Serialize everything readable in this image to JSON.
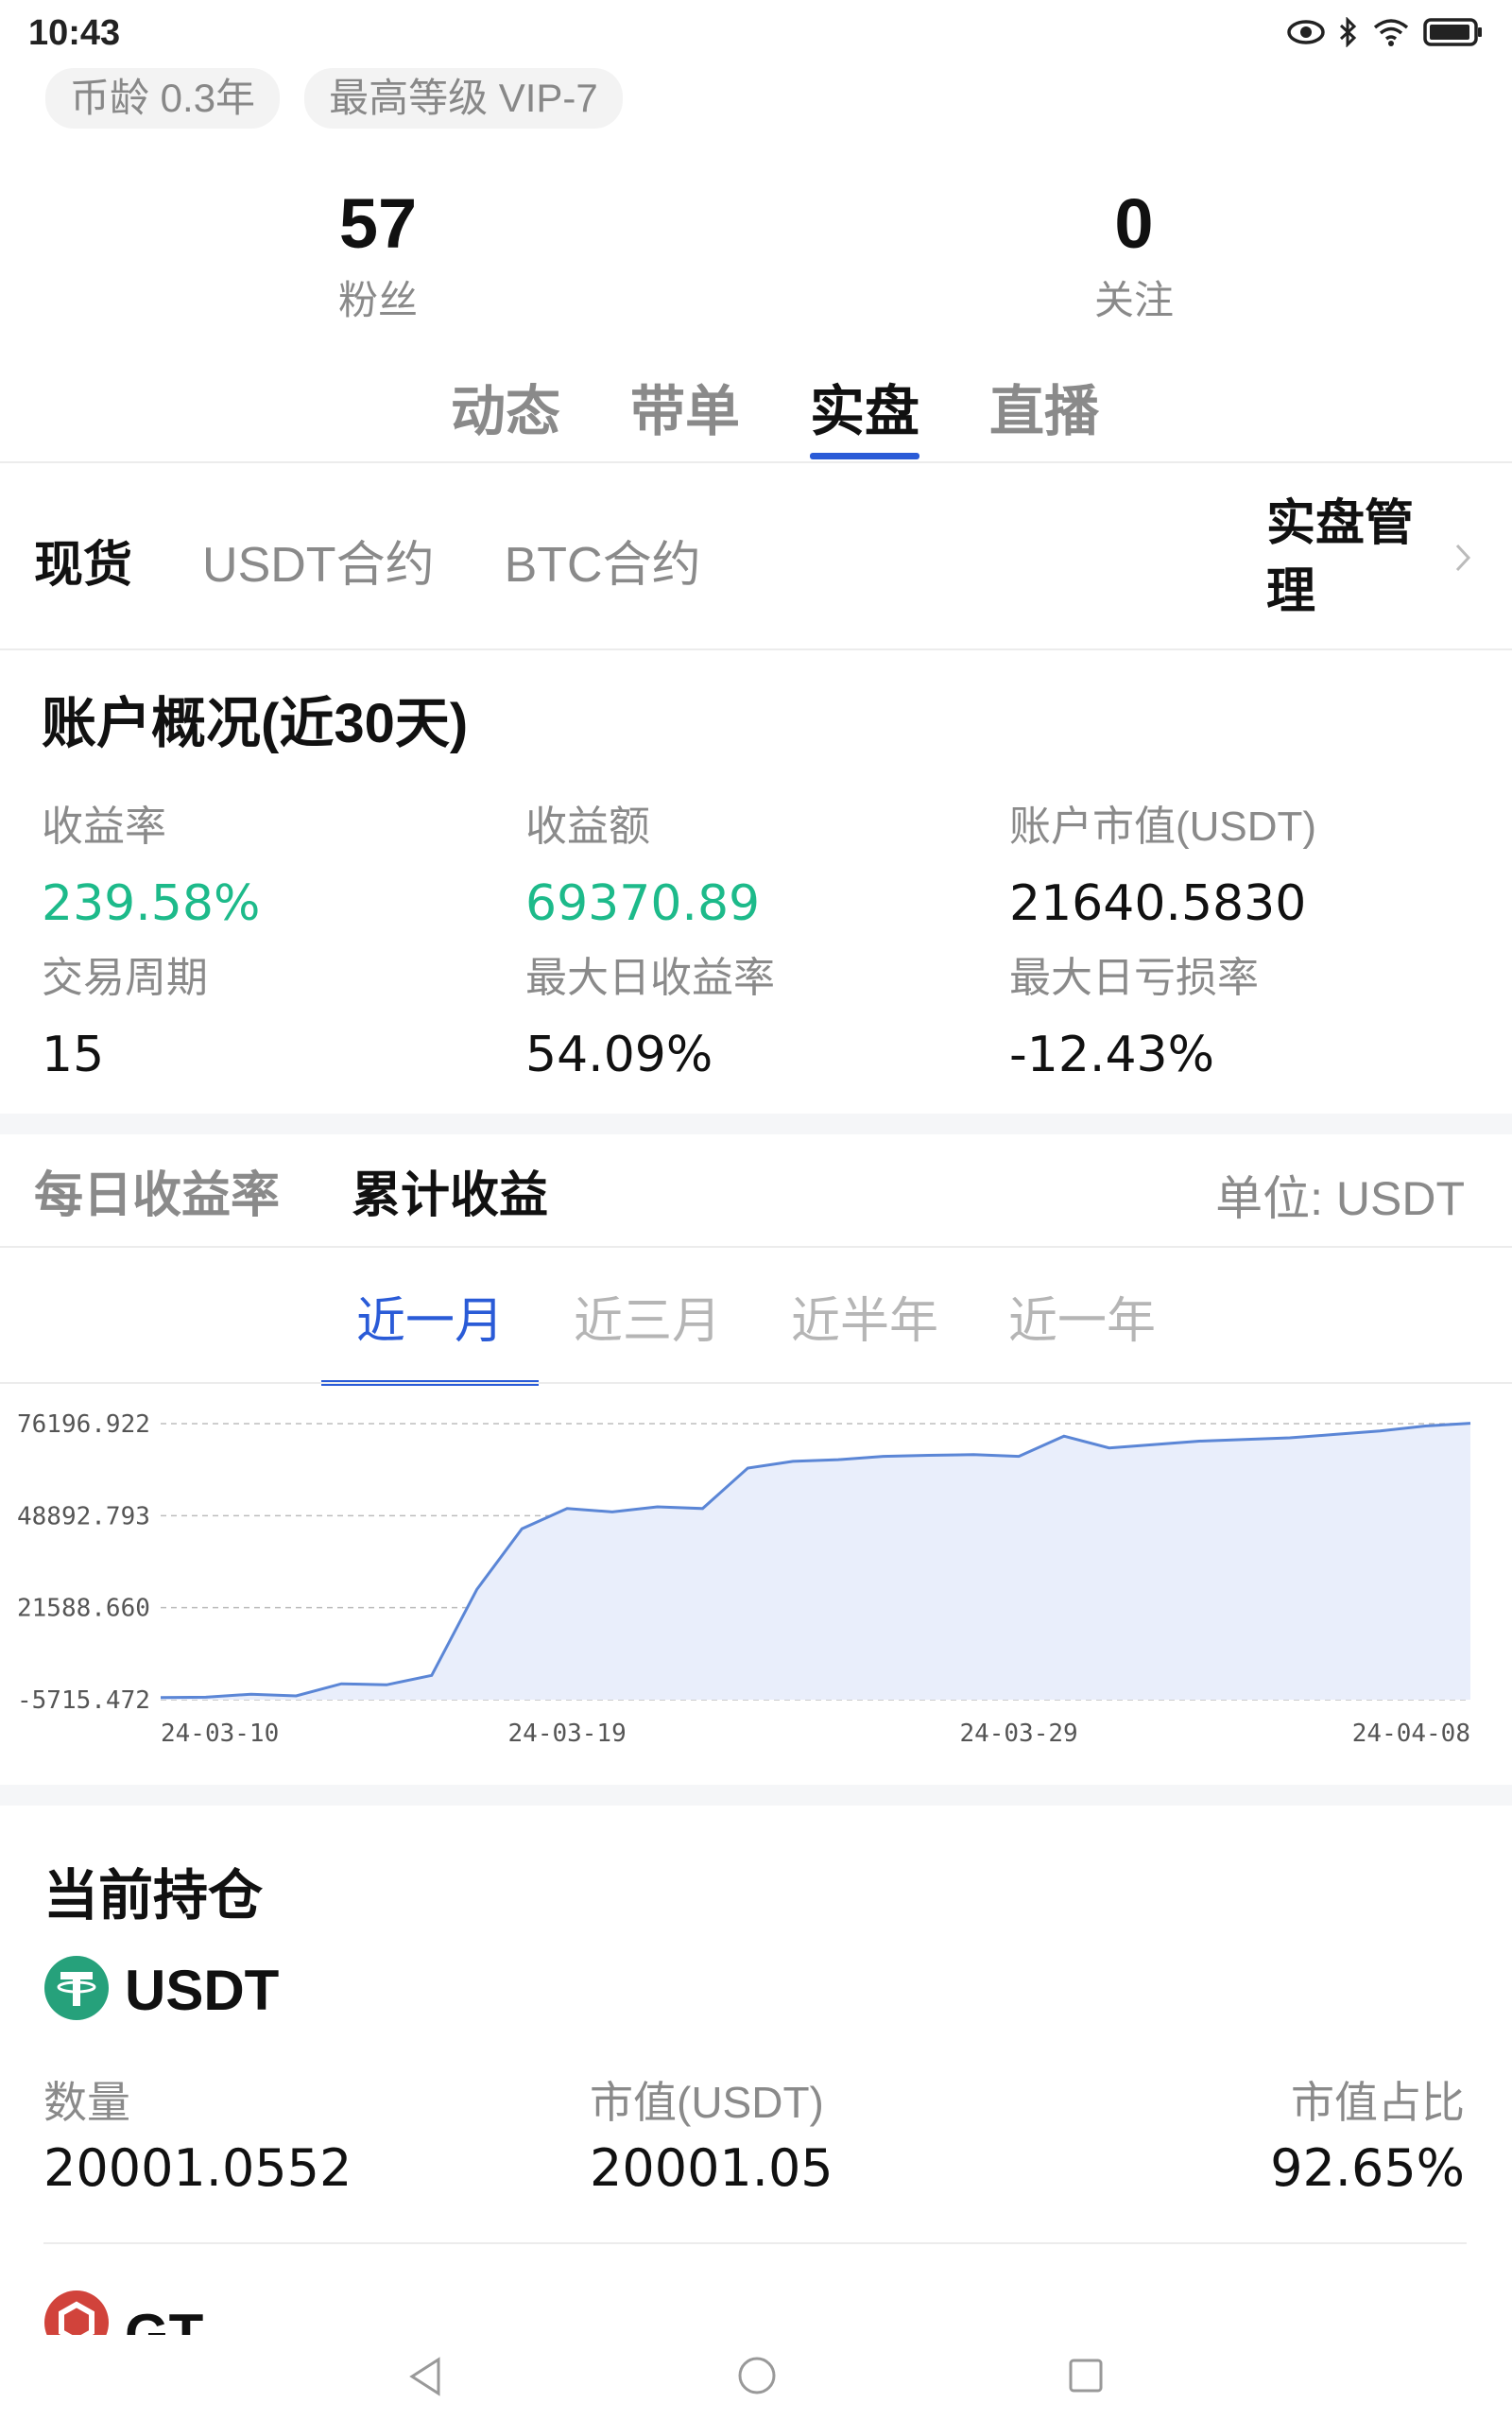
{
  "status_bar": {
    "time": "10:43"
  },
  "profile": {
    "chips": [
      "币龄 0.3年",
      "最高等级 VIP-7"
    ],
    "fans": {
      "count": "57",
      "label": "粉丝"
    },
    "following": {
      "count": "0",
      "label": "关注"
    }
  },
  "main_tabs": [
    "动态",
    "带单",
    "实盘",
    "直播"
  ],
  "main_tab_active": 2,
  "sub_tabs": [
    "现货",
    "USDT合约",
    "BTC合约"
  ],
  "sub_tab_active": 0,
  "manage_label": "实盘管理",
  "overview": {
    "title": "账户概况(近30天)",
    "metrics": [
      {
        "label": "收益率",
        "value": "239.58%"
      },
      {
        "label": "收益额",
        "value": "69370.89"
      },
      {
        "label": "账户市值(USDT)",
        "value": "21640.5830"
      },
      {
        "label": "交易周期",
        "value": "15"
      },
      {
        "label": "最大日收益率",
        "value": "54.09%"
      },
      {
        "label": "最大日亏损率",
        "value": "-12.43%"
      }
    ]
  },
  "chart_section": {
    "tabs": [
      "每日收益率",
      "累计收益"
    ],
    "active_tab": 1,
    "unit": "单位:  USDT",
    "ranges": [
      "近一月",
      "近三月",
      "近半年",
      "近一年"
    ],
    "active_range": 0
  },
  "chart_data": {
    "type": "area",
    "x": [
      "24-03-10",
      "24-03-11",
      "24-03-12",
      "24-03-13",
      "24-03-14",
      "24-03-15",
      "24-03-16",
      "24-03-17",
      "24-03-18",
      "24-03-19",
      "24-03-20",
      "24-03-21",
      "24-03-22",
      "24-03-23",
      "24-03-24",
      "24-03-25",
      "24-03-26",
      "24-03-27",
      "24-03-28",
      "24-03-29",
      "24-03-30",
      "24-03-31",
      "24-04-01",
      "24-04-02",
      "24-04-03",
      "24-04-04",
      "24-04-05",
      "24-04-06",
      "24-04-07",
      "24-04-08"
    ],
    "values": [
      -5100,
      -5000,
      -4100,
      -4600,
      -1000,
      -1300,
      1500,
      27000,
      45000,
      51000,
      50000,
      51500,
      51000,
      63000,
      65000,
      65500,
      66500,
      66800,
      67000,
      66500,
      72500,
      69000,
      70000,
      71000,
      71500,
      72000,
      73000,
      74000,
      75500,
      76300
    ],
    "yticks": [
      "76196.922",
      "48892.793",
      "21588.660",
      "-5715.472"
    ],
    "ytick_values": [
      76196.922,
      48892.793,
      21588.66,
      -5715.472
    ],
    "xticks": [
      "24-03-10",
      "24-03-19",
      "24-03-29",
      "24-04-08"
    ],
    "ylim": [
      -5715.472,
      76196.922
    ],
    "grid": true,
    "line_color": "#5b86d6",
    "fill_color": "#e9eefb"
  },
  "holdings": {
    "title": "当前持仓",
    "coins": [
      {
        "name": "USDT",
        "icon": "tether-icon",
        "labels": [
          "数量",
          "市值(USDT)",
          "市值占比"
        ],
        "values": [
          "20001.0552",
          "20001.05",
          "92.65%"
        ]
      },
      {
        "name": "GT",
        "icon": "gt-icon"
      }
    ]
  },
  "colors": {
    "accent": "#2a5bd7",
    "positive": "#1dba8a",
    "usdt": "#26a17b",
    "gt": "#d1433b"
  }
}
